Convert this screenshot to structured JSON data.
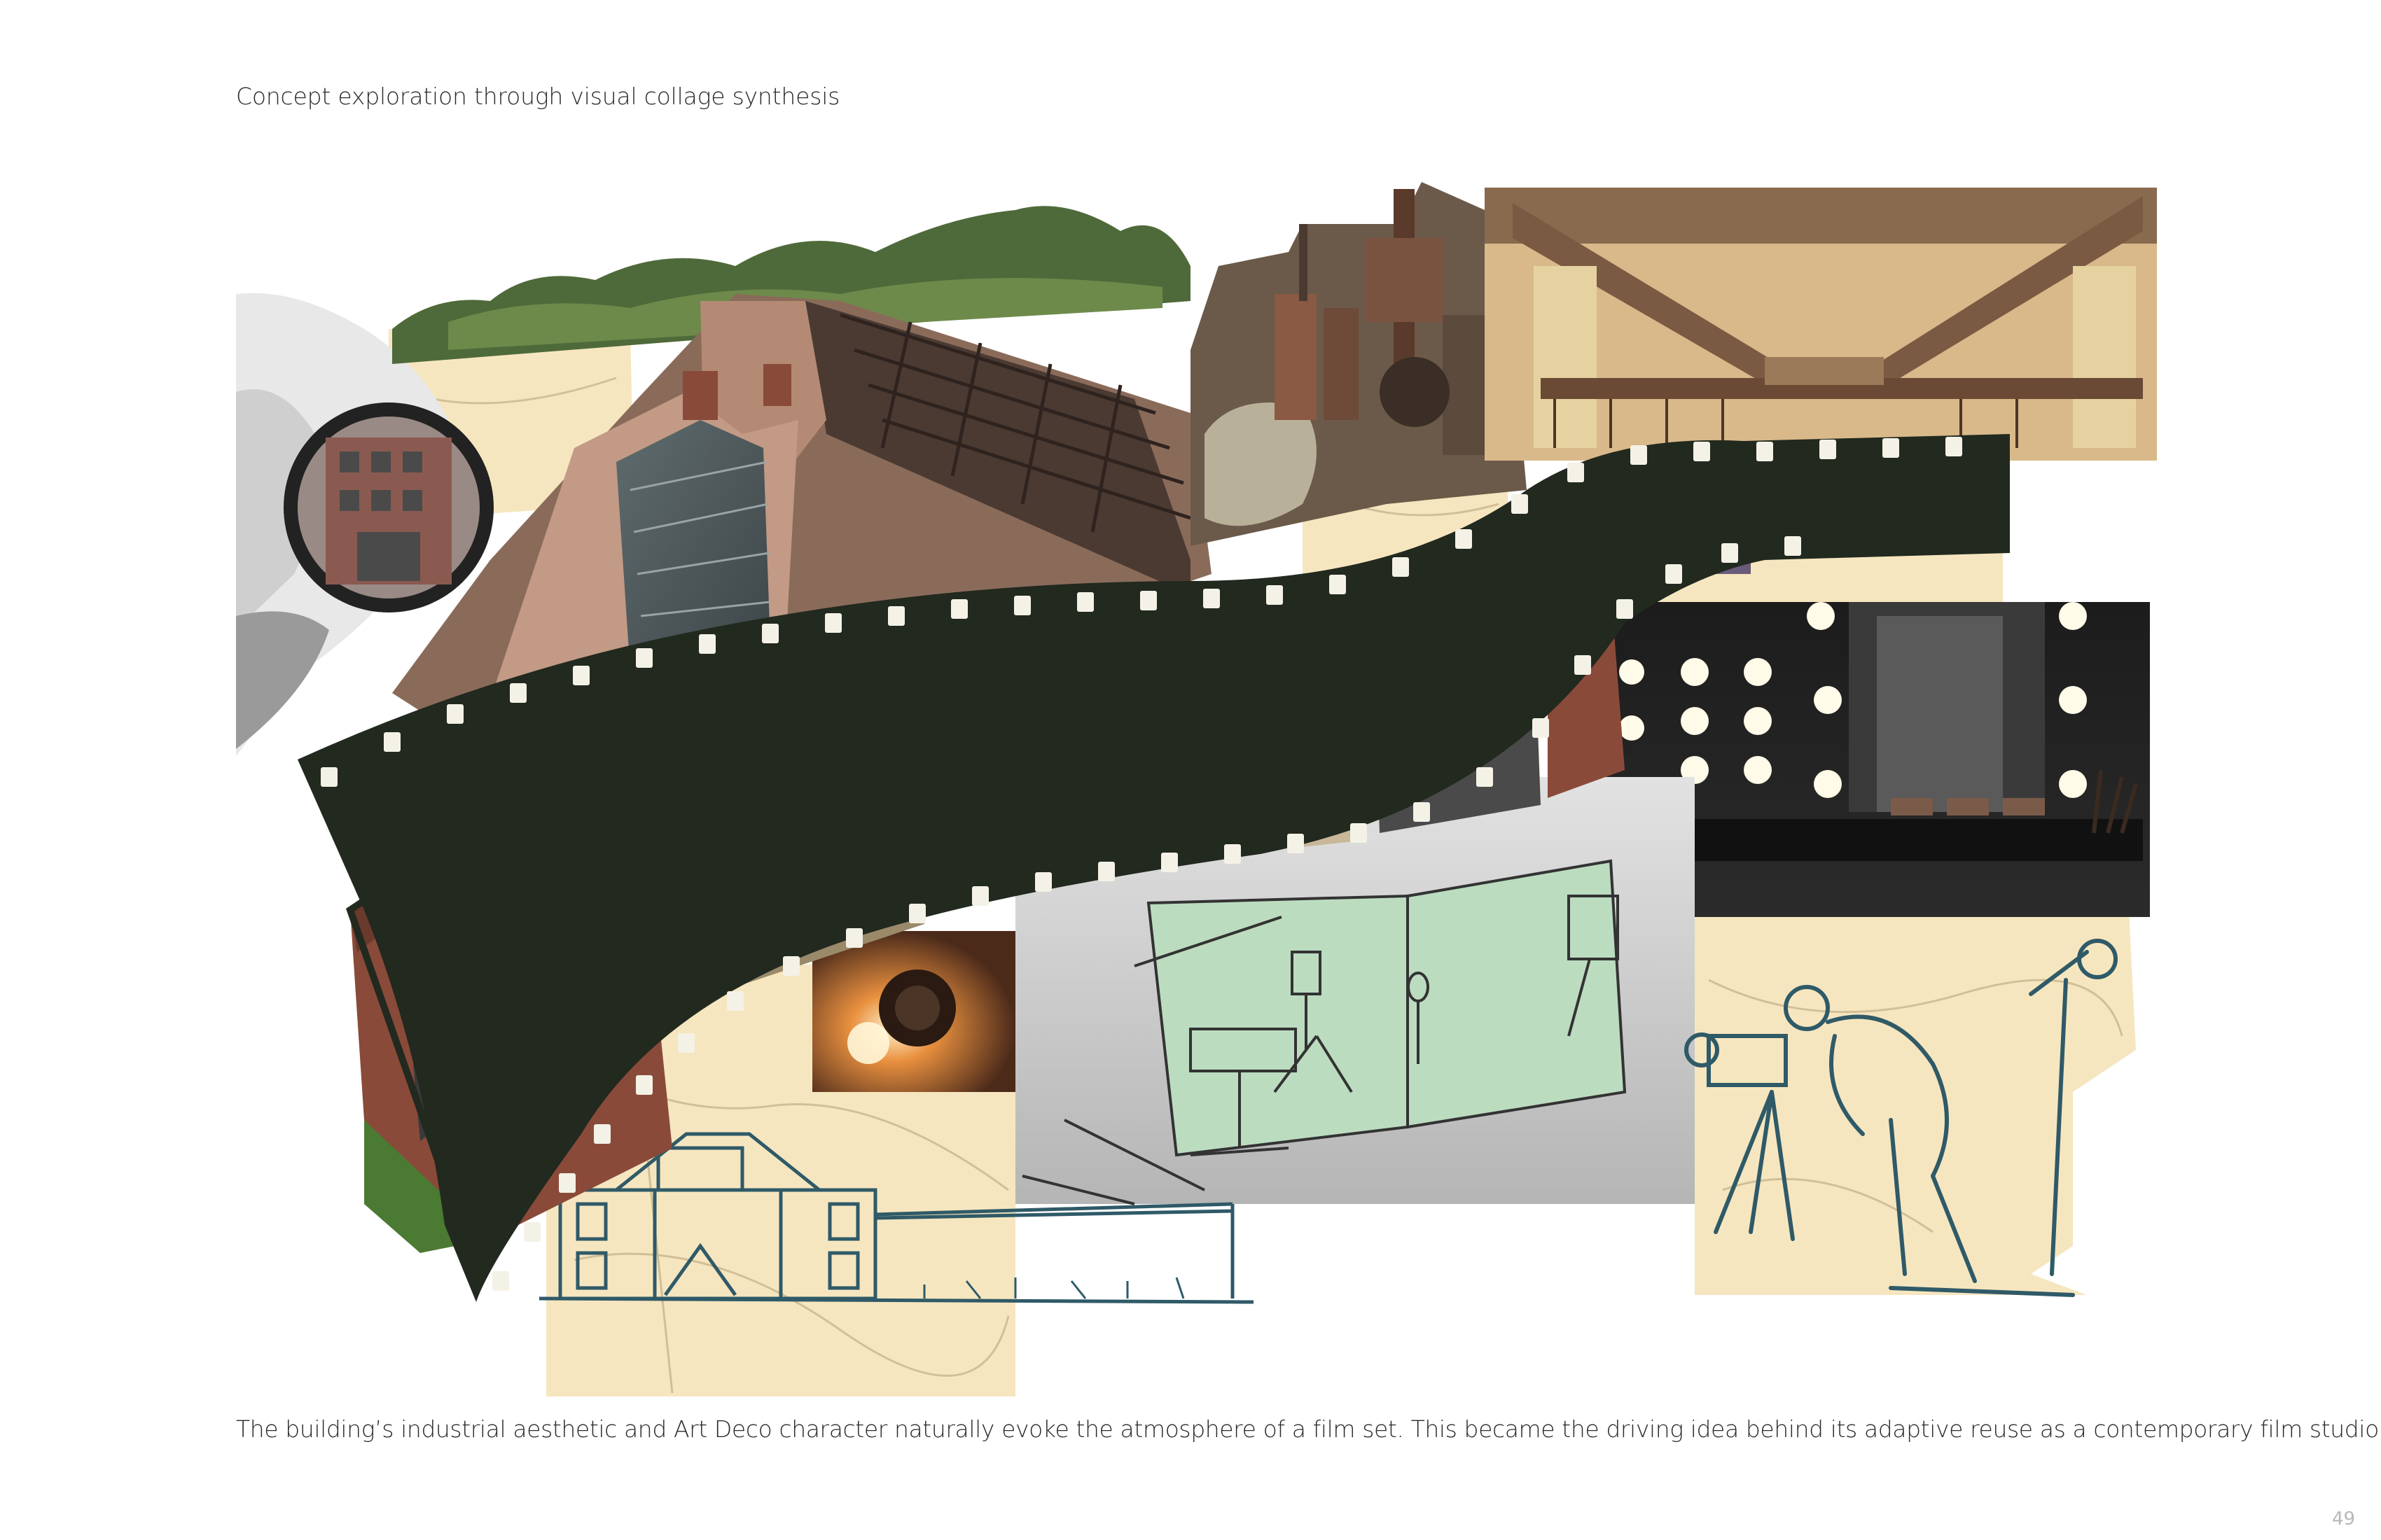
{
  "page": {
    "header": "Concept exploration through visual collage synthesis",
    "caption": "The building’s industrial aesthetic and Art Deco character naturally evoke the atmosphere of a film set. This became the driving idea behind its adaptive reuse as a contemporary film studio.",
    "page_number": "49"
  },
  "colors": {
    "film_strip": "#22291f",
    "map_paper": "#f6e6bf",
    "green_screen": "#bcdcc0",
    "brick": "#8a4a3a",
    "sketch_ink": "#2f5a68"
  }
}
